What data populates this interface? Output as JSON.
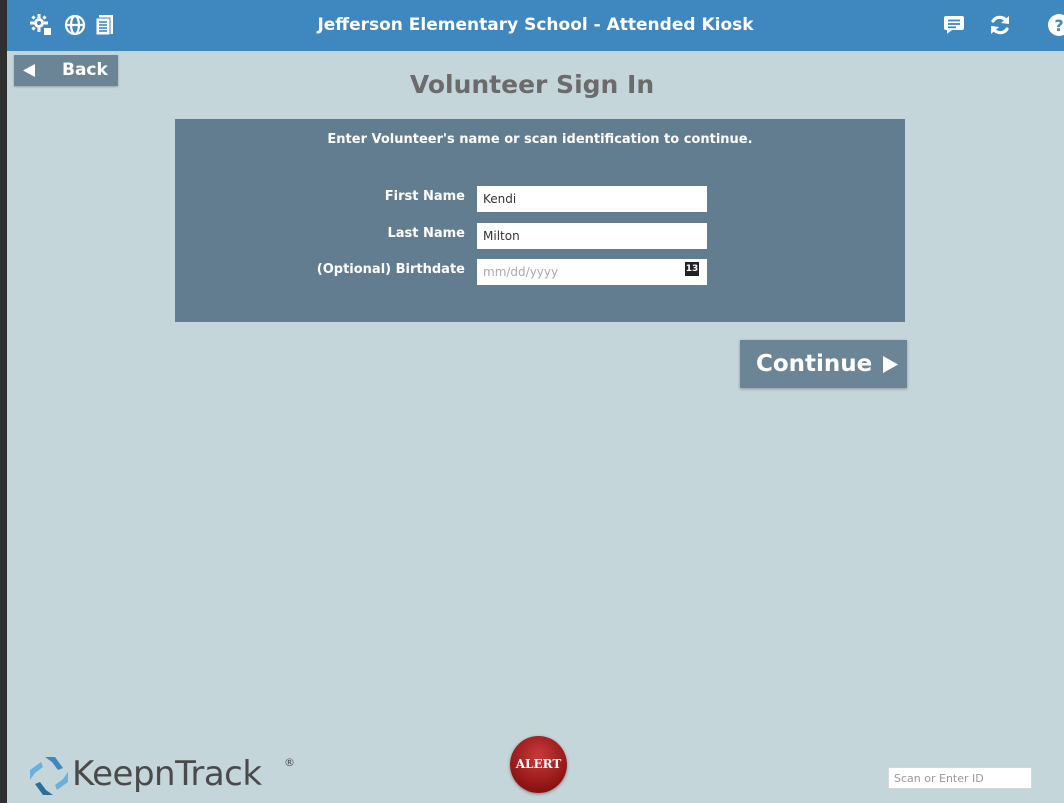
{
  "header": {
    "title": "Jefferson Elementary School - Attended Kiosk",
    "left_icons": [
      "gear-puzzle-icon",
      "globe-icon",
      "document-icon"
    ],
    "right_icons": [
      "chat-icon",
      "refresh-icon",
      "help-icon"
    ]
  },
  "nav": {
    "back_label": "Back"
  },
  "page": {
    "title": "Volunteer Sign In"
  },
  "form": {
    "instruction": "Enter Volunteer's name or scan identification to continue.",
    "first_name_label": "First Name",
    "first_name_value": "Kendi",
    "last_name_label": "Last Name",
    "last_name_value": "Milton",
    "birthdate_label": "(Optional) Birthdate",
    "birthdate_placeholder": "mm/dd/yyyy",
    "calendar_day": "13"
  },
  "actions": {
    "continue_label": "Continue"
  },
  "footer": {
    "logo_text": "KeepnTrack",
    "logo_mark": "®",
    "alert_label": "ALERT",
    "scan_placeholder": "Scan or Enter ID"
  },
  "colors": {
    "header_bg": "#3f87bf",
    "page_bg": "#c5d6db",
    "panel_bg": "#627d8f",
    "button_bg": "#6b8597",
    "alert_red": "#8e1414"
  }
}
